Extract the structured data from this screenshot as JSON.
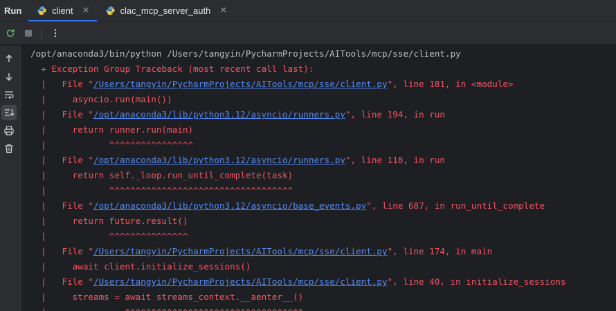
{
  "header": {
    "title": "Run",
    "tabs": [
      {
        "label": "client",
        "active": true
      },
      {
        "label": "clac_mcp_server_auth",
        "active": false
      }
    ],
    "close_glyph": "✕"
  },
  "toolbar": {
    "buttons": [
      "rerun-icon",
      "stop-icon",
      "more-options-icon"
    ]
  },
  "gutter": {
    "buttons": [
      "arrow-up-icon",
      "arrow-down-icon",
      "soft-wrap-icon",
      "scroll-to-end-icon",
      "print-icon",
      "trash-icon"
    ]
  },
  "console": {
    "command": "/opt/anaconda3/bin/python /Users/tangyin/PycharmProjects/AITools/mcp/sse/client.py",
    "header": "  + Exception Group Traceback (most recent call last):",
    "lines": [
      {
        "pre": "  |   File \"",
        "link": "/Users/tangyin/PycharmProjects/AITools/mcp/sse/client.py",
        "post": "\", line 181, in <module>"
      },
      {
        "text": "  |     asyncio.run(main())"
      },
      {
        "pre": "  |   File \"",
        "link": "/opt/anaconda3/lib/python3.12/asyncio/runners.py",
        "post": "\", line 194, in run"
      },
      {
        "text": "  |     return runner.run(main)"
      },
      {
        "text": "  |            ^^^^^^^^^^^^^^^^"
      },
      {
        "pre": "  |   File \"",
        "link": "/opt/anaconda3/lib/python3.12/asyncio/runners.py",
        "post": "\", line 118, in run"
      },
      {
        "text": "  |     return self._loop.run_until_complete(task)"
      },
      {
        "text": "  |            ^^^^^^^^^^^^^^^^^^^^^^^^^^^^^^^^^^^"
      },
      {
        "pre": "  |   File \"",
        "link": "/opt/anaconda3/lib/python3.12/asyncio/base_events.py",
        "post": "\", line 687, in run_until_complete"
      },
      {
        "text": "  |     return future.result()"
      },
      {
        "text": "  |            ^^^^^^^^^^^^^^^"
      },
      {
        "pre": "  |   File \"",
        "link": "/Users/tangyin/PycharmProjects/AITools/mcp/sse/client.py",
        "post": "\", line 174, in main"
      },
      {
        "text": "  |     await client.initialize_sessions()"
      },
      {
        "pre": "  |   File \"",
        "link": "/Users/tangyin/PycharmProjects/AITools/mcp/sse/client.py",
        "post": "\", line 40, in initialize_sessions"
      },
      {
        "text": "  |     streams = await streams_context.__aenter__()"
      },
      {
        "text": "  |               ^^^^^^^^^^^^^^^^^^^^^^^^^^^^^^^^^^"
      }
    ]
  },
  "colors": {
    "background": "#1e1f22",
    "panel": "#2b2d30",
    "error": "#f75464",
    "link": "#548af7",
    "accent": "#3574f0"
  }
}
